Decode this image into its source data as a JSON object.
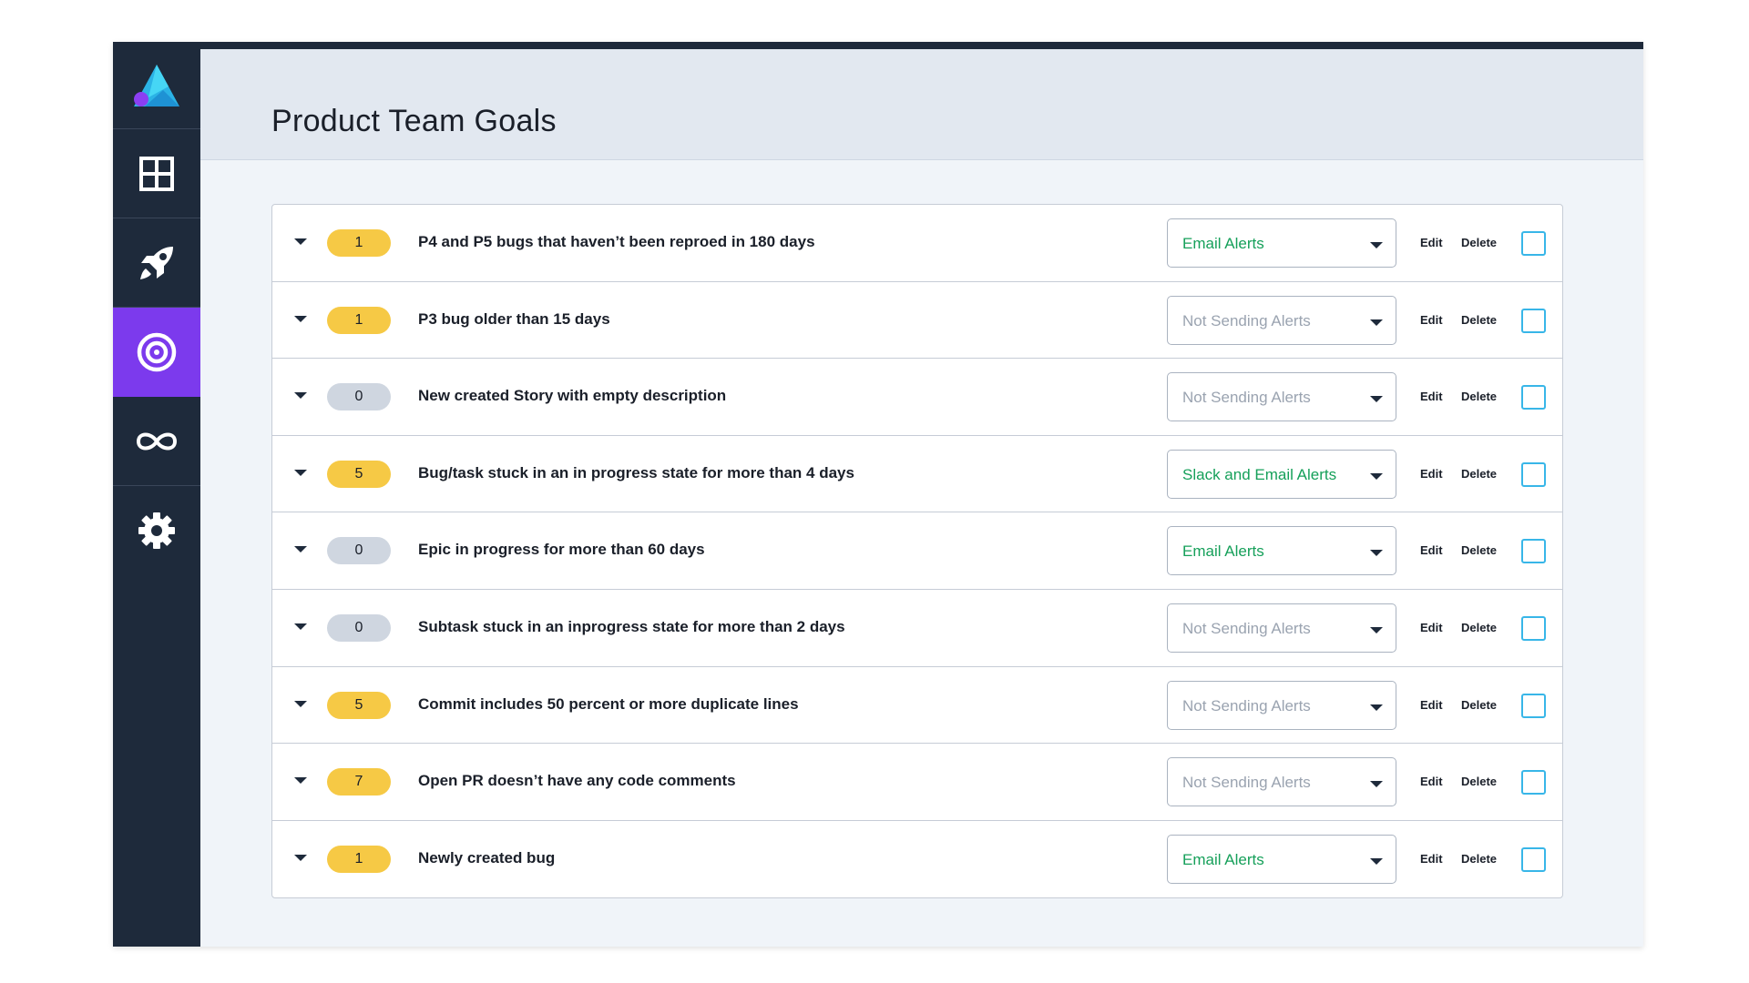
{
  "page": {
    "title": "Product Team Goals"
  },
  "sidebar": {
    "items": [
      {
        "name": "logo",
        "icon": "logo-icon"
      },
      {
        "name": "dashboard",
        "icon": "grid-icon"
      },
      {
        "name": "launch",
        "icon": "rocket-icon"
      },
      {
        "name": "goals",
        "icon": "target-icon",
        "active": true
      },
      {
        "name": "loop",
        "icon": "infinity-icon"
      },
      {
        "name": "settings",
        "icon": "gear-icon"
      }
    ]
  },
  "colors": {
    "sidebar_bg": "#1e2a3b",
    "active_item": "#7c3aed",
    "badge_yellow": "#f6c945",
    "badge_gray": "#cfd6e0",
    "alert_on": "#16a05a",
    "alert_off": "#9aa3b0",
    "checkbox_border": "#38b6e8"
  },
  "actions": {
    "edit_label": "Edit",
    "delete_label": "Delete"
  },
  "goals": [
    {
      "count": "1",
      "badge": "yellow",
      "label": "P4 and P5 bugs that haven’t been reproed in 180 days",
      "alert": "Email Alerts",
      "alert_active": true
    },
    {
      "count": "1",
      "badge": "yellow",
      "label": "P3 bug older than 15 days",
      "alert": "Not Sending Alerts",
      "alert_active": false
    },
    {
      "count": "0",
      "badge": "gray",
      "label": "New created Story with empty description",
      "alert": "Not Sending Alerts",
      "alert_active": false
    },
    {
      "count": "5",
      "badge": "yellow",
      "label": "Bug/task stuck in an in progress state for more than 4 days",
      "alert": "Slack and Email Alerts",
      "alert_active": true
    },
    {
      "count": "0",
      "badge": "gray",
      "label": "Epic in progress for more than 60 days",
      "alert": "Email Alerts",
      "alert_active": true
    },
    {
      "count": "0",
      "badge": "gray",
      "label": "Subtask stuck in an inprogress state for more than 2 days",
      "alert": "Not Sending Alerts",
      "alert_active": false
    },
    {
      "count": "5",
      "badge": "yellow",
      "label": "Commit includes 50 percent or more duplicate lines",
      "alert": "Not Sending Alerts",
      "alert_active": false
    },
    {
      "count": "7",
      "badge": "yellow",
      "label": "Open PR doesn’t have any code comments",
      "alert": "Not Sending Alerts",
      "alert_active": false
    },
    {
      "count": "1",
      "badge": "yellow",
      "label": "Newly created bug",
      "alert": "Email Alerts",
      "alert_active": true
    }
  ]
}
